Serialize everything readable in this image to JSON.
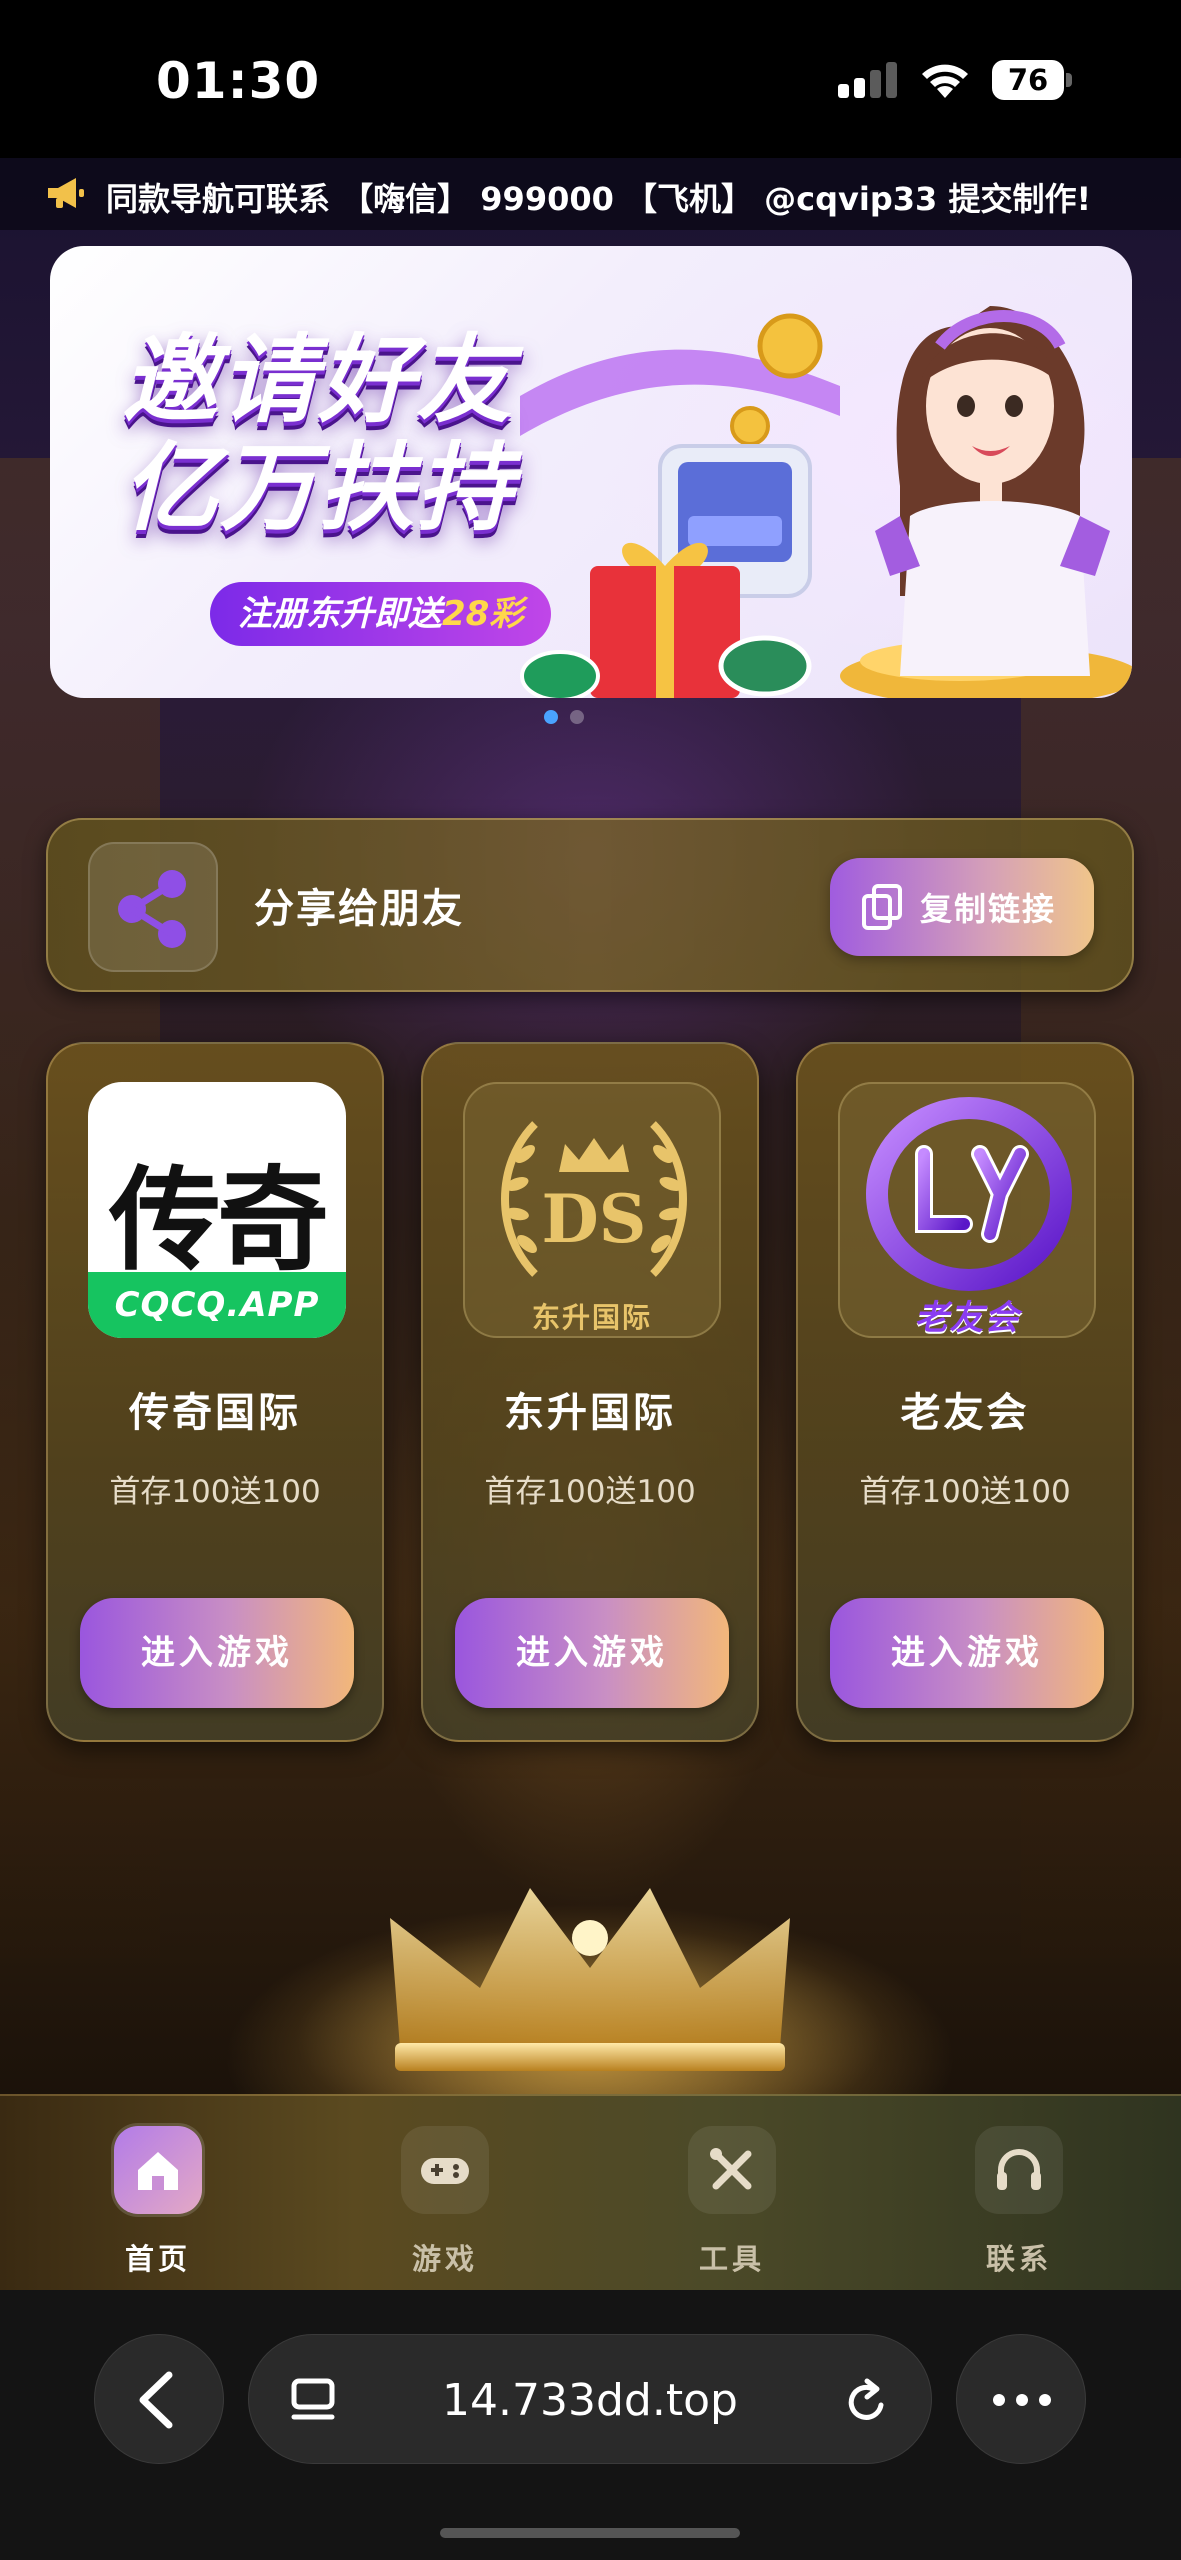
{
  "status": {
    "time": "01:30",
    "battery": "76"
  },
  "marquee": {
    "text": "同款导航可联系 【嗨信】 999000 【飞机】 @cqvip33 提交制作!"
  },
  "banner": {
    "line1": "邀请好友",
    "line2": "亿万扶持",
    "pill_prefix": "注册东升即送",
    "pill_highlight": "28彩",
    "slide_count": 2,
    "active_slide": 1
  },
  "share": {
    "label": "分享给朋友",
    "copy_button": "复制链接"
  },
  "games": [
    {
      "name": "传奇国际",
      "promo": "首存100送100",
      "button": "进入游戏",
      "logo_text": "传奇",
      "logo_subtext": "CQCQ.APP"
    },
    {
      "name": "东升国际",
      "promo": "首存100送100",
      "button": "进入游戏",
      "logo_text": "东升国际",
      "logo_monogram": "DS"
    },
    {
      "name": "老友会",
      "promo": "首存100送100",
      "button": "进入游戏",
      "logo_text": "老友会"
    }
  ],
  "tabbar": {
    "items": [
      {
        "label": "首页",
        "icon": "home-icon",
        "active": true
      },
      {
        "label": "游戏",
        "icon": "gamepad-icon",
        "active": false
      },
      {
        "label": "工具",
        "icon": "tools-icon",
        "active": false
      },
      {
        "label": "联系",
        "icon": "headset-icon",
        "active": false
      }
    ]
  },
  "browser": {
    "url": "14.733dd.top"
  },
  "colors": {
    "accent_purple": "#9a56de",
    "accent_peach": "#f2b77a",
    "cq_green": "#16c460",
    "gold": "#e8c46a"
  }
}
